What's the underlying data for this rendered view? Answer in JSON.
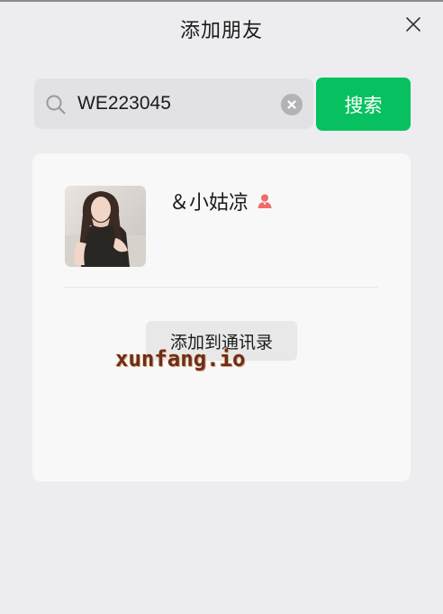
{
  "window": {
    "title": "添加朋友"
  },
  "search": {
    "value": "WE223045"
  },
  "search_button": {
    "label": "搜索"
  },
  "result": {
    "name": "＆小姑凉",
    "gender": "female",
    "add_button_label": "添加到通讯录"
  },
  "watermark": {
    "text": "xunfang.io"
  },
  "colors": {
    "accent": "#07c160",
    "background": "#ededf0",
    "card": "#f8f8f8",
    "female_icon": "#f06a6a"
  },
  "icons": [
    "close-icon",
    "search-icon",
    "clear-icon",
    "female-icon"
  ]
}
